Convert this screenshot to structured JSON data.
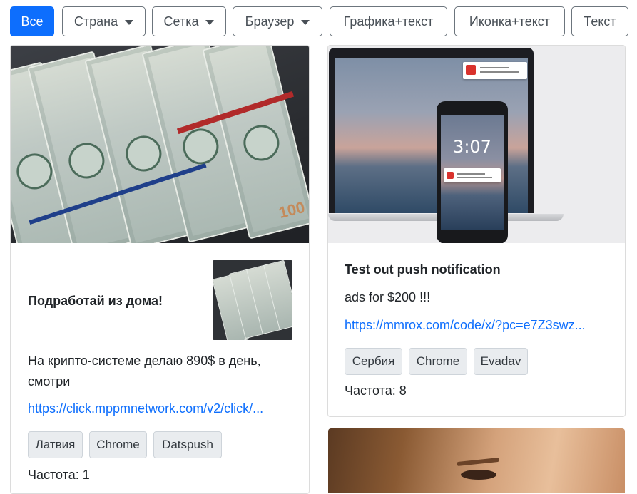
{
  "filters": [
    {
      "label": "Все",
      "active": true,
      "dropdown": false
    },
    {
      "label": "Страна",
      "active": false,
      "dropdown": true
    },
    {
      "label": "Сетка",
      "active": false,
      "dropdown": true
    },
    {
      "label": "Браузер",
      "active": false,
      "dropdown": true
    },
    {
      "label": "Графика+текст",
      "active": false,
      "dropdown": false
    },
    {
      "label": "Иконка+текст",
      "active": false,
      "dropdown": false
    },
    {
      "label": "Текст",
      "active": false,
      "dropdown": false
    }
  ],
  "cards": [
    {
      "title": "Подработай из дома!",
      "text": "На крипто-системе делаю 890$ в день, смотри",
      "link": "https://click.mppmnetwork.com/v2/click/...",
      "tags": [
        "Латвия",
        "Chrome",
        "Datspush"
      ],
      "frequency": "Частота: 1"
    },
    {
      "title": "Test out push notification",
      "text": "ads for $200 !!!",
      "link": "https://mmrox.com/code/x/?pc=e7Z3swz...",
      "tags": [
        "Сербия",
        "Chrome",
        "Evadav"
      ],
      "frequency": "Частота: 8"
    }
  ],
  "phone_time": "3:07",
  "bill_number": "100",
  "colors": {
    "accent": "#0d6efd",
    "link": "#0d6efd",
    "tag_bg": "#e9ecef"
  }
}
